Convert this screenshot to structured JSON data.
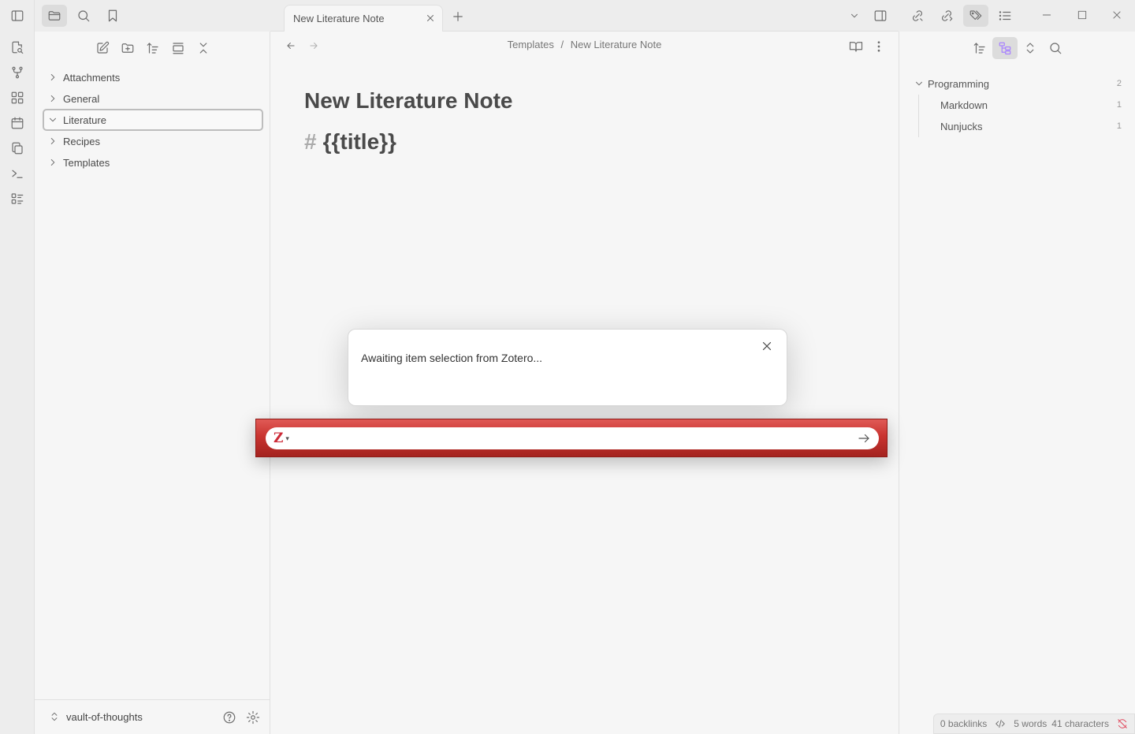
{
  "tab": {
    "title": "New Literature Note"
  },
  "breadcrumb": {
    "folder": "Templates",
    "separator": "/",
    "note": "New Literature Note"
  },
  "note": {
    "title": "New Literature Note",
    "heading_hash": "#",
    "heading_text": "{{title}}"
  },
  "file_tree": {
    "items": [
      {
        "label": "Attachments",
        "expanded": false,
        "selected": false
      },
      {
        "label": "General",
        "expanded": false,
        "selected": false
      },
      {
        "label": "Literature",
        "expanded": true,
        "selected": true
      },
      {
        "label": "Recipes",
        "expanded": false,
        "selected": false
      },
      {
        "label": "Templates",
        "expanded": false,
        "selected": false
      }
    ]
  },
  "vault": {
    "name": "vault-of-thoughts"
  },
  "tags": {
    "parent": {
      "label": "Programming",
      "count": "2"
    },
    "children": [
      {
        "label": "Markdown",
        "count": "1"
      },
      {
        "label": "Nunjucks",
        "count": "1"
      }
    ]
  },
  "status": {
    "backlinks": "0 backlinks",
    "words": "5 words",
    "characters": "41 characters"
  },
  "modal": {
    "message": "Awaiting item selection from Zotero..."
  },
  "zotero": {
    "logo": "Z",
    "dropdown": "▾",
    "input_value": ""
  },
  "colors": {
    "accent": "#a882ff",
    "zotero_red": "#cc2936",
    "zotero_bar": "#c93430"
  }
}
